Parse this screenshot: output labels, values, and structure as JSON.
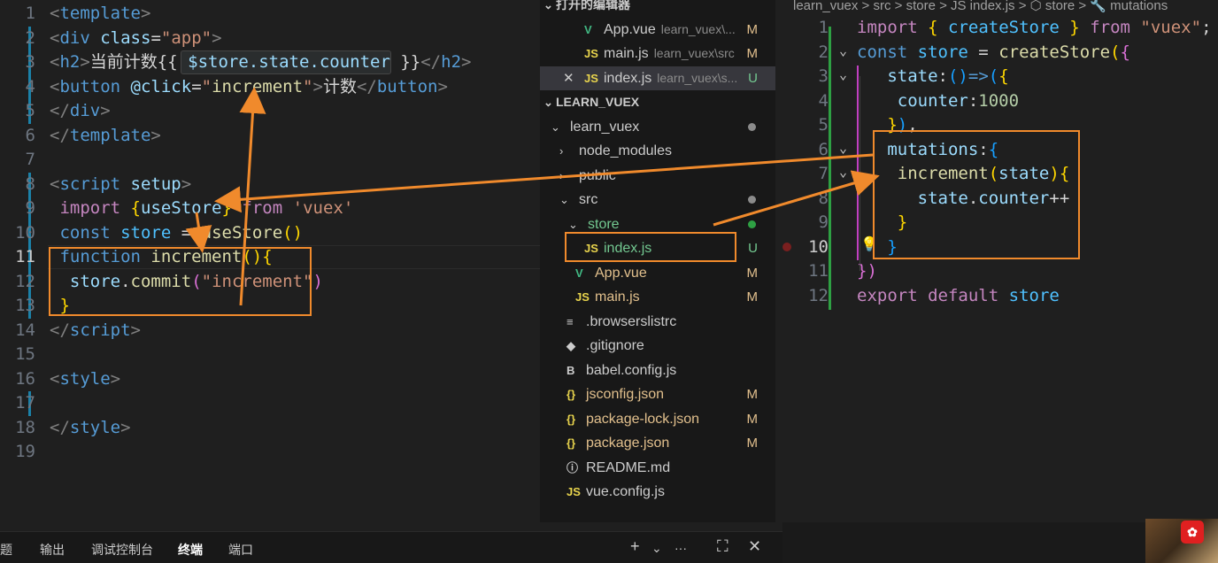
{
  "left_editor": {
    "lines": [
      {
        "n": "1",
        "tokens": [
          [
            "t-tag",
            "<"
          ],
          [
            "t-tn",
            "template"
          ],
          [
            "t-tag",
            ">"
          ]
        ]
      },
      {
        "n": "2",
        "tokens": [
          [
            "t-tag",
            "<"
          ],
          [
            "t-tn",
            "div"
          ],
          [
            "t-txt",
            " "
          ],
          [
            "t-attr",
            "class"
          ],
          [
            "t-txt",
            "="
          ],
          [
            "t-str",
            "\"app\""
          ],
          [
            "t-tag",
            ">"
          ]
        ]
      },
      {
        "n": "3",
        "tokens": [
          [
            "t-tag",
            "<"
          ],
          [
            "t-tn",
            "h2"
          ],
          [
            "t-tag",
            ">"
          ],
          [
            "t-txt",
            "当前计数{{ "
          ],
          [
            "t-attr",
            "$store.state.counter"
          ],
          [
            "t-txt",
            " }}"
          ],
          [
            "t-tag",
            "</"
          ],
          [
            "t-tn",
            "h2"
          ],
          [
            "t-tag",
            ">"
          ]
        ]
      },
      {
        "n": "4",
        "tokens": [
          [
            "t-tag",
            "<"
          ],
          [
            "t-tn",
            "button"
          ],
          [
            "t-txt",
            " "
          ],
          [
            "t-attr",
            "@click"
          ],
          [
            "t-txt",
            "="
          ],
          [
            "t-str",
            "\""
          ],
          [
            "t-fn",
            "increment"
          ],
          [
            "t-str",
            "\""
          ],
          [
            "t-tag",
            ">"
          ],
          [
            "t-txt",
            "计数"
          ],
          [
            "t-tag",
            "</"
          ],
          [
            "t-tn",
            "button"
          ],
          [
            "t-tag",
            ">"
          ]
        ]
      },
      {
        "n": "5",
        "tokens": [
          [
            "t-tag",
            "</"
          ],
          [
            "t-tn",
            "div"
          ],
          [
            "t-tag",
            ">"
          ]
        ]
      },
      {
        "n": "6",
        "tokens": [
          [
            "t-tag",
            "</"
          ],
          [
            "t-tn",
            "template"
          ],
          [
            "t-tag",
            ">"
          ]
        ]
      },
      {
        "n": "7",
        "tokens": []
      },
      {
        "n": "8",
        "tokens": [
          [
            "t-tag",
            "<"
          ],
          [
            "t-tn",
            "script"
          ],
          [
            "t-txt",
            " "
          ],
          [
            "t-attr",
            "setup"
          ],
          [
            "t-tag",
            ">"
          ]
        ]
      },
      {
        "n": "9",
        "tokens": [
          [
            "t-kw",
            " import"
          ],
          [
            "t-txt",
            " "
          ],
          [
            "t-br1",
            "{"
          ],
          [
            "t-attr",
            "useStore"
          ],
          [
            "t-br1",
            "}"
          ],
          [
            "t-txt",
            " "
          ],
          [
            "t-kw",
            "from"
          ],
          [
            "t-txt",
            " "
          ],
          [
            "t-str",
            "'vuex'"
          ]
        ]
      },
      {
        "n": "10",
        "tokens": [
          [
            "t-tn",
            " const"
          ],
          [
            "t-txt",
            " "
          ],
          [
            "t-var",
            "store"
          ],
          [
            "t-txt",
            " = "
          ],
          [
            "t-fn",
            "useStore"
          ],
          [
            "t-br1",
            "()"
          ]
        ]
      },
      {
        "n": "11",
        "tokens": [
          [
            "t-tn",
            " function"
          ],
          [
            "t-txt",
            " "
          ],
          [
            "t-fn",
            "increment"
          ],
          [
            "t-br1",
            "()"
          ],
          [
            "t-br1",
            "{"
          ]
        ]
      },
      {
        "n": "12",
        "tokens": [
          [
            "t-txt",
            "  "
          ],
          [
            "t-attr",
            "store"
          ],
          [
            "t-txt",
            "."
          ],
          [
            "t-fn",
            "commit"
          ],
          [
            "t-br2",
            "("
          ],
          [
            "t-str",
            "\"increment\""
          ],
          [
            "t-br2",
            ")"
          ]
        ]
      },
      {
        "n": "13",
        "tokens": [
          [
            "t-br1",
            " }"
          ]
        ]
      },
      {
        "n": "14",
        "tokens": [
          [
            "t-tag",
            "</"
          ],
          [
            "t-tn",
            "script"
          ],
          [
            "t-tag",
            ">"
          ]
        ]
      },
      {
        "n": "15",
        "tokens": []
      },
      {
        "n": "16",
        "tokens": [
          [
            "t-tag",
            "<"
          ],
          [
            "t-tn",
            "style"
          ],
          [
            "t-tag",
            ">"
          ]
        ]
      },
      {
        "n": "17",
        "tokens": []
      },
      {
        "n": "18",
        "tokens": [
          [
            "t-tag",
            "</"
          ],
          [
            "t-tn",
            "style"
          ],
          [
            "t-tag",
            ">"
          ]
        ]
      },
      {
        "n": "19",
        "tokens": []
      }
    ],
    "current_line": "11"
  },
  "explorer": {
    "open_editors_header": "打开的编辑器",
    "open_editors": [
      {
        "icon": "vue",
        "name": "App.vue",
        "desc": "learn_vuex\\...",
        "status": "M"
      },
      {
        "icon": "js",
        "name": "main.js",
        "desc": "learn_vuex\\src",
        "status": "M"
      },
      {
        "icon": "js",
        "name": "index.js",
        "desc": "learn_vuex\\s...",
        "status": "U"
      }
    ],
    "workspace_header": "LEARN_VUEX",
    "tree": [
      {
        "kind": "folder-open",
        "name": "learn_vuex",
        "depth": 0,
        "dot": "#8b8b8b"
      },
      {
        "kind": "folder",
        "name": "node_modules",
        "depth": 1
      },
      {
        "kind": "folder",
        "name": "public",
        "depth": 1
      },
      {
        "kind": "folder-open",
        "name": "src",
        "depth": 1,
        "dot": "#8b8b8b"
      },
      {
        "kind": "folder-open",
        "name": "store",
        "depth": 2,
        "dot": "#2ea043"
      },
      {
        "kind": "file",
        "icon": "js",
        "name": "index.js",
        "depth": 3,
        "status": "U"
      },
      {
        "kind": "file",
        "icon": "vue",
        "name": "App.vue",
        "depth": 2,
        "status": "M"
      },
      {
        "kind": "file",
        "icon": "js",
        "name": "main.js",
        "depth": 2,
        "status": "M"
      },
      {
        "kind": "file",
        "icon": "list",
        "name": ".browserslistrc",
        "depth": 1
      },
      {
        "kind": "file",
        "icon": "git",
        "name": ".gitignore",
        "depth": 1
      },
      {
        "kind": "file",
        "icon": "babel",
        "name": "babel.config.js",
        "depth": 1
      },
      {
        "kind": "file",
        "icon": "json",
        "name": "jsconfig.json",
        "depth": 1,
        "status": "M"
      },
      {
        "kind": "file",
        "icon": "json",
        "name": "package-lock.json",
        "depth": 1,
        "status": "M"
      },
      {
        "kind": "file",
        "icon": "json",
        "name": "package.json",
        "depth": 1,
        "status": "M"
      },
      {
        "kind": "file",
        "icon": "info",
        "name": "README.md",
        "depth": 1
      },
      {
        "kind": "file",
        "icon": "js",
        "name": "vue.config.js",
        "depth": 1
      }
    ]
  },
  "breadcrumb": {
    "text": "learn_vuex > src > store > JS index.js > ⬡ store > 🔧 mutations"
  },
  "right_editor": {
    "lines": [
      {
        "n": "1",
        "tokens": [
          [
            "t-kw",
            "import"
          ],
          [
            "t-txt",
            " "
          ],
          [
            "t-br1",
            "{"
          ],
          [
            "t-txt",
            " "
          ],
          [
            "t-var",
            "createStore"
          ],
          [
            "t-txt",
            " "
          ],
          [
            "t-br1",
            "}"
          ],
          [
            "t-txt",
            " "
          ],
          [
            "t-kw",
            "from"
          ],
          [
            "t-txt",
            " "
          ],
          [
            "t-str",
            "\"vuex\""
          ],
          [
            "t-txt",
            ";"
          ]
        ]
      },
      {
        "n": "2",
        "tokens": [
          [
            "t-tn",
            "const"
          ],
          [
            "t-txt",
            " "
          ],
          [
            "t-var",
            "store"
          ],
          [
            "t-txt",
            " = "
          ],
          [
            "t-fn",
            "createStore"
          ],
          [
            "t-br1",
            "("
          ],
          [
            "t-br2",
            "{"
          ]
        ]
      },
      {
        "n": "3",
        "tokens": [
          [
            "t-txt",
            "   "
          ],
          [
            "t-prop",
            "state"
          ],
          [
            "t-txt",
            ":"
          ],
          [
            "t-br3",
            "()"
          ],
          [
            "t-tn",
            "=>"
          ],
          [
            "t-br3",
            "("
          ],
          [
            "t-br1",
            "{"
          ]
        ]
      },
      {
        "n": "4",
        "tokens": [
          [
            "t-txt",
            "    "
          ],
          [
            "t-prop",
            "counter"
          ],
          [
            "t-txt",
            ":"
          ],
          [
            "t-num",
            "1000"
          ]
        ]
      },
      {
        "n": "5",
        "tokens": [
          [
            "t-txt",
            "   "
          ],
          [
            "t-br1",
            "}"
          ],
          [
            "t-br3",
            ")"
          ],
          [
            "t-txt",
            ","
          ]
        ]
      },
      {
        "n": "6",
        "tokens": [
          [
            "t-txt",
            "   "
          ],
          [
            "t-prop",
            "mutations"
          ],
          [
            "t-txt",
            ":"
          ],
          [
            "t-br3",
            "{"
          ]
        ]
      },
      {
        "n": "7",
        "tokens": [
          [
            "t-txt",
            "    "
          ],
          [
            "t-fn",
            "increment"
          ],
          [
            "t-br1",
            "("
          ],
          [
            "t-prop",
            "state"
          ],
          [
            "t-br1",
            ")"
          ],
          [
            "t-br1",
            "{"
          ]
        ]
      },
      {
        "n": "8",
        "tokens": [
          [
            "t-txt",
            "      "
          ],
          [
            "t-prop",
            "state"
          ],
          [
            "t-txt",
            "."
          ],
          [
            "t-prop",
            "counter"
          ],
          [
            "t-txt",
            "++"
          ]
        ]
      },
      {
        "n": "9",
        "tokens": [
          [
            "t-txt",
            "    "
          ],
          [
            "t-br1",
            "}"
          ]
        ]
      },
      {
        "n": "10",
        "tokens": [
          [
            "t-txt",
            "   "
          ],
          [
            "t-br3",
            "}"
          ]
        ]
      },
      {
        "n": "11",
        "tokens": [
          [
            "t-br2",
            "})"
          ]
        ]
      },
      {
        "n": "12",
        "tokens": [
          [
            "t-kw",
            "export"
          ],
          [
            "t-txt",
            " "
          ],
          [
            "t-kw",
            "default"
          ],
          [
            "t-txt",
            " "
          ],
          [
            "t-var",
            "store"
          ]
        ]
      }
    ],
    "current_line": "10"
  },
  "panel": {
    "tabs": [
      "题",
      "输出",
      "调试控制台",
      "终端",
      "端口"
    ],
    "active_tab": "终端",
    "tools": [
      "+",
      "⌄",
      "···",
      "⛶",
      "✕"
    ]
  },
  "colors": {
    "annotation": "#f08a2c",
    "accent": "#1b81a8"
  }
}
